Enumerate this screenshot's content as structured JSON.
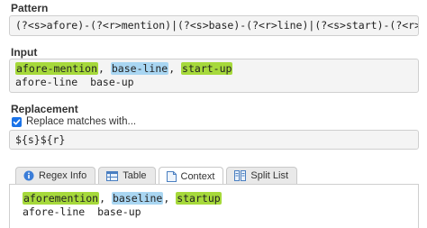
{
  "pattern": {
    "label": "Pattern",
    "value": "(?<s>afore)-(?<r>mention)|(?<s>base)-(?<r>line)|(?<s>start)-(?<r>up)"
  },
  "input": {
    "label": "Input",
    "line1": {
      "match1": "afore-mention",
      "sep1": ", ",
      "match2": "base-line",
      "sep2": ", ",
      "match3": "start-up"
    },
    "line2": "afore-line  base-up"
  },
  "replacement": {
    "label": "Replacement",
    "checkbox_label": "Replace matches with...",
    "checked": true,
    "value": "${s}${r}"
  },
  "tabs": [
    {
      "label": "Regex Info",
      "icon": "info-icon",
      "active": false
    },
    {
      "label": "Table",
      "icon": "table-icon",
      "active": false
    },
    {
      "label": "Context",
      "icon": "document-icon",
      "active": true
    },
    {
      "label": "Split List",
      "icon": "split-list-icon",
      "active": false
    }
  ],
  "result": {
    "line1": {
      "match1": "aforemention",
      "sep1": ", ",
      "match2": "baseline",
      "sep2": ", ",
      "match3": "startup"
    },
    "line2": "afore-line  base-up"
  },
  "colors": {
    "highlight_green": "#a6d93b",
    "highlight_blue": "#a9d6f2",
    "checkbox_blue": "#1a73e8"
  }
}
